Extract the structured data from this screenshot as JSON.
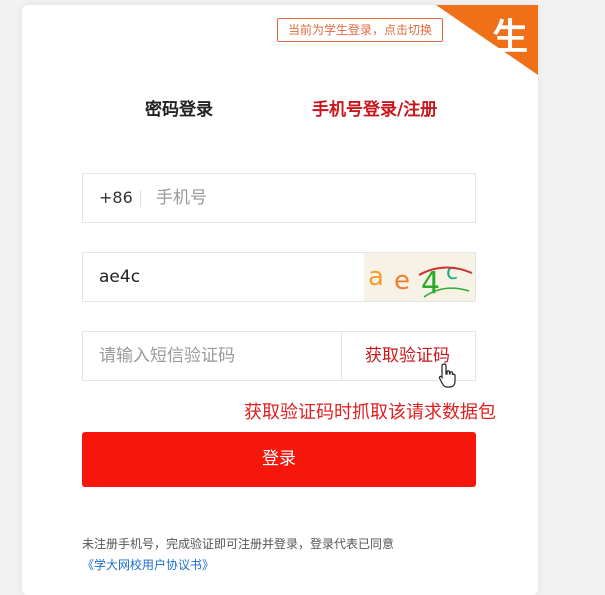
{
  "colors": {
    "accent": "#c9161b",
    "button": "#f7160c",
    "corner": "#f07019",
    "annotation": "#e02020"
  },
  "switch_tip": "当前为学生登录，点击切换",
  "corner_badge": "生",
  "tabs": {
    "password": "密码登录",
    "phone": "手机号登录/注册"
  },
  "phone": {
    "prefix": "+86",
    "placeholder": "手机号"
  },
  "captcha": {
    "value": "ae4c",
    "image_text": "ae4c"
  },
  "sms": {
    "placeholder": "请输入短信验证码",
    "button": "获取验证码"
  },
  "annotation": "获取验证码时抓取该请求数据包",
  "login_button": "登录",
  "note": "未注册手机号，完成验证即可注册并登录，登录代表已同意",
  "agreement_link": "《学大网校用户协议书》",
  "icons": {
    "cursor": "hand-pointer-icon"
  }
}
